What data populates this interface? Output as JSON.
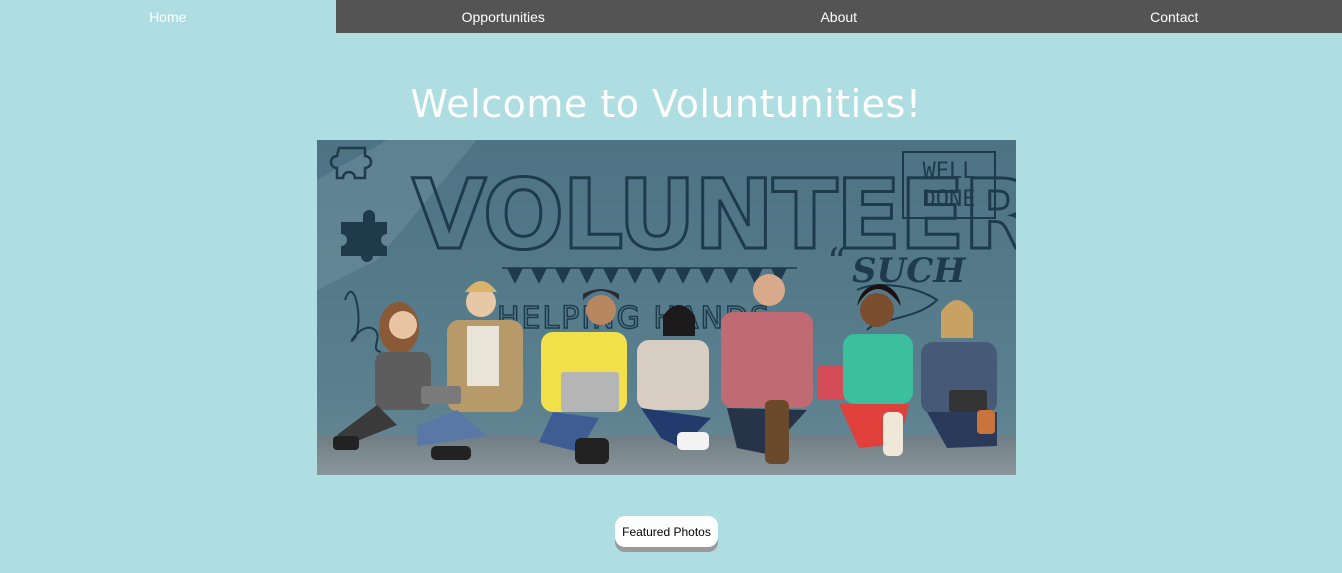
{
  "nav": {
    "items": [
      {
        "label": "Home",
        "active": true
      },
      {
        "label": "Opportunities",
        "active": false
      },
      {
        "label": "About",
        "active": false
      },
      {
        "label": "Contact",
        "active": false
      }
    ],
    "bar_color": "#545454",
    "active_color": "#aedde2"
  },
  "main": {
    "title": "Welcome to Voluntunities!",
    "hero_image": {
      "wall_text": "VOLUNTEER",
      "sign_line1": "WELL",
      "sign_line2": "DONE",
      "script_text": "SUCH",
      "helping_text": "HELPING HANDS"
    },
    "featured_button_label": "Featured Photos"
  },
  "colors": {
    "background": "#aedde2",
    "text": "#ffffff"
  }
}
